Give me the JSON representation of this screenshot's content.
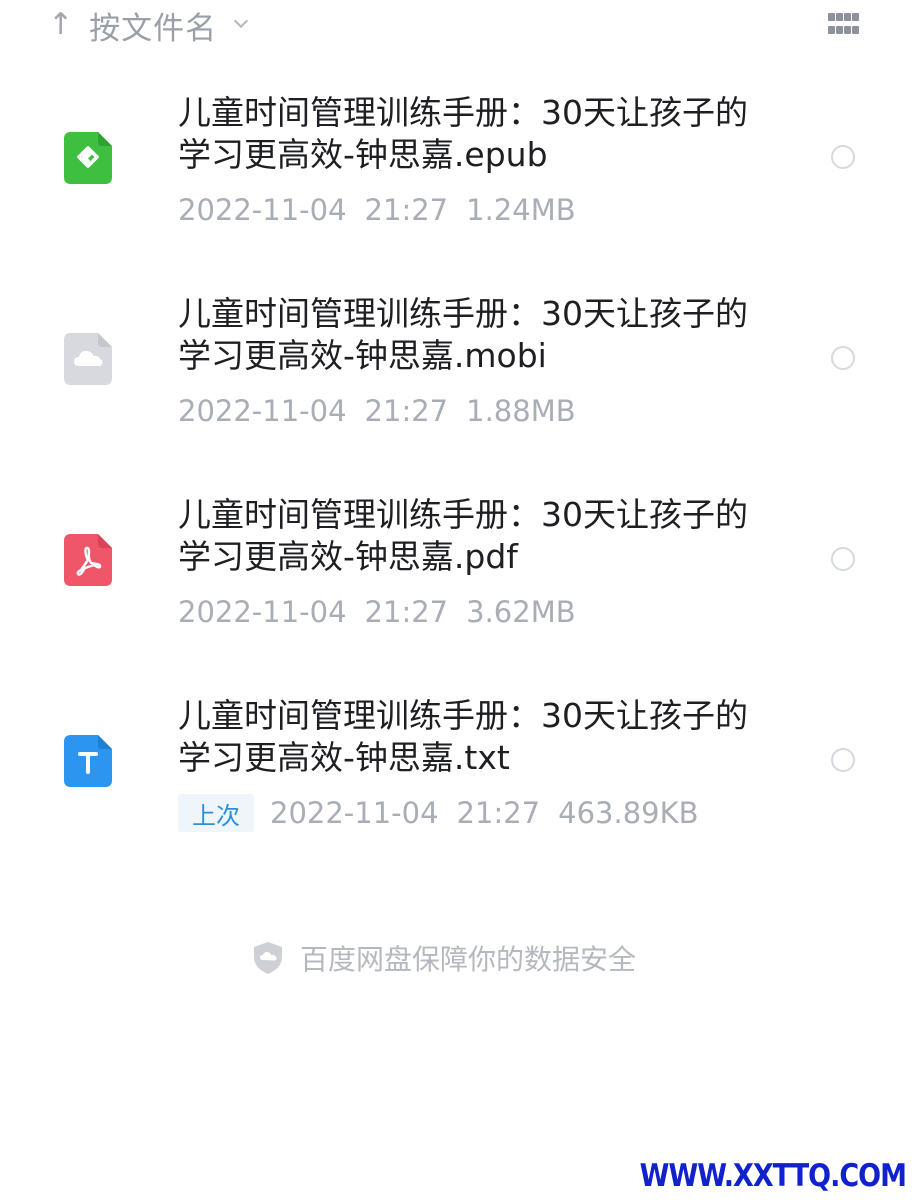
{
  "sort": {
    "arrow": "↑",
    "label": "按文件名"
  },
  "view_toggle": {
    "icon": "grid-icon"
  },
  "files": [
    {
      "name": "儿童时间管理训练手册：30天让孩子的学习更高效-钟思嘉.epub",
      "type": "epub",
      "date": "2022-11-04",
      "time": "21:27",
      "size": "1.24MB",
      "badge": "",
      "icon_color": "#3fbf3f"
    },
    {
      "name": "儿童时间管理训练手册：30天让孩子的学习更高效-钟思嘉.mobi",
      "type": "mobi",
      "date": "2022-11-04",
      "time": "21:27",
      "size": "1.88MB",
      "badge": "",
      "icon_color": "#d7d9de"
    },
    {
      "name": "儿童时间管理训练手册：30天让孩子的学习更高效-钟思嘉.pdf",
      "type": "pdf",
      "date": "2022-11-04",
      "time": "21:27",
      "size": "3.62MB",
      "badge": "",
      "icon_color": "#f0566a"
    },
    {
      "name": "儿童时间管理训练手册：30天让孩子的学习更高效-钟思嘉.txt",
      "type": "txt",
      "date": "2022-11-04",
      "time": "21:27",
      "size": "463.89KB",
      "badge": "上次",
      "icon_color": "#2b95f0"
    }
  ],
  "footer": {
    "security_text": "百度网盘保障你的数据安全"
  },
  "watermark": "WWW.XXTTQ.COM"
}
